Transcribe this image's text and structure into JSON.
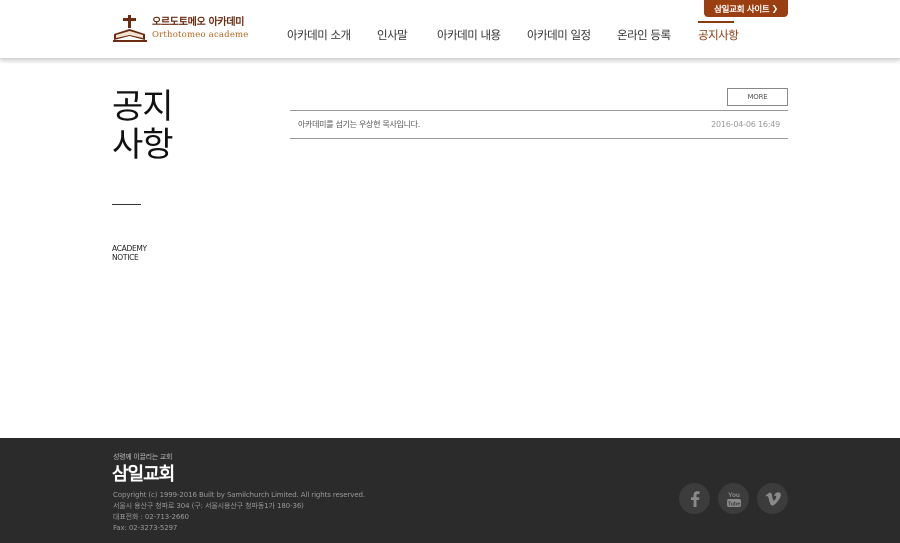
{
  "header": {
    "logo_ko": "오르도토메오 아카데미",
    "logo_en": "Orthotomeo academe",
    "site_button": "삼일교회 사이트"
  },
  "nav": {
    "items": [
      {
        "label": "아카데미 소개"
      },
      {
        "label": "인사말"
      },
      {
        "label": "아카데미 내용"
      },
      {
        "label": "아카데미 일정"
      },
      {
        "label": "온라인 등록"
      },
      {
        "label": "공지사항",
        "active": true
      }
    ]
  },
  "page": {
    "title_line1": "공지",
    "title_line2": "사항",
    "subtitle_line1": "ACADEMY",
    "subtitle_line2": "NOTICE"
  },
  "notices": {
    "more_label": "MORE",
    "items": [
      {
        "title": "아카데미를 섬기는 우상현 목사입니다.",
        "date": "2016-04-06 16:49"
      }
    ]
  },
  "footer": {
    "slogan": "성령께 이끌리는 교회",
    "church_name": "삼일교회",
    "copyright": "Copyright (c) 1999-2016 Built by Samilchurch Limited. All rights reserved.",
    "address": "서울시 용산구 청파로 304 (구: 서울시용산구 청파동1가 180-36)",
    "phone": "대표전화 : 02-713-2660",
    "fax": "Fax: 02-3273-5297",
    "social": [
      {
        "icon": "facebook-icon"
      },
      {
        "icon": "youtube-icon",
        "label": "You Tube"
      },
      {
        "icon": "vimeo-icon"
      }
    ]
  },
  "colors": {
    "brand": "#8b3a12",
    "button": "#9a3f12",
    "footer_bg": "#2b2b2b"
  }
}
